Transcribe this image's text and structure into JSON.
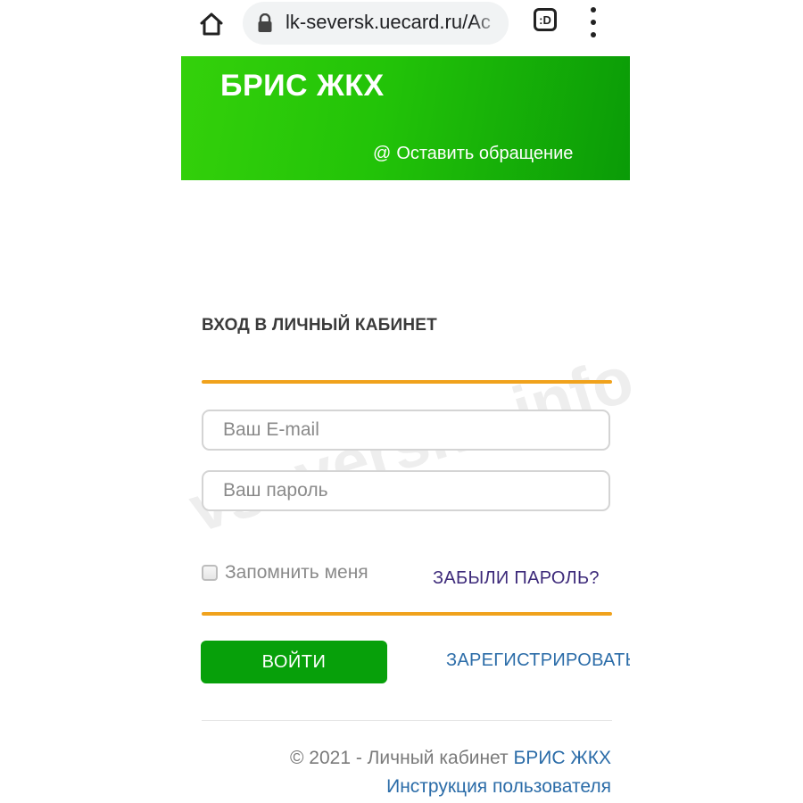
{
  "browser": {
    "url": "lk-seversk.uecard.ru/Ac",
    "tabs_count": ":D"
  },
  "header": {
    "brand": "БРИС ЖКХ",
    "feedback_icon": "@",
    "feedback_label": "Оставить обращение"
  },
  "login": {
    "title": "ВХОД В ЛИЧНЫЙ КАБИНЕТ",
    "email_placeholder": "Ваш E-mail",
    "password_placeholder": "Ваш пароль",
    "remember_label": "Запомнить меня",
    "remember_checked": false,
    "forgot_label": "ЗАБЫЛИ ПАРОЛЬ?",
    "submit_label": "ВОЙТИ",
    "register_label": "ЗАРЕГИСТРИРОВАТЬС"
  },
  "footer": {
    "copyright_prefix": "© 2021 - Личный кабинет ",
    "brand_link": "БРИС ЖКХ",
    "manual_link": "Инструкция пользователя"
  },
  "watermark": "vseverske.info",
  "icons": {
    "home": "home-icon",
    "lock": "lock-icon",
    "tabs": "tabs-icon",
    "menu": "more-vert-icon",
    "checkbox": "checkbox-icon"
  },
  "colors": {
    "banner_start": "#34d10b",
    "banner_end": "#0a9b07",
    "accent_rule": "#f0a21c",
    "login_button": "#07a00a",
    "link_blue": "#2b6ca8",
    "link_purple": "#3d2a7a"
  }
}
